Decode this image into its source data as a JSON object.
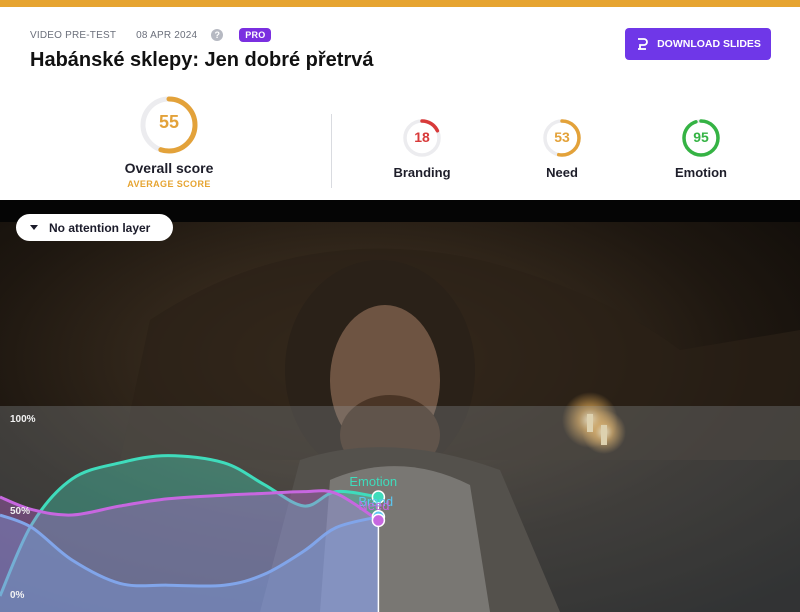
{
  "header": {
    "type": "VIDEO PRE-TEST",
    "date": "08 APR 2024",
    "help": "?",
    "badge": "PRO",
    "title": "Habánské sklepy: Jen dobré přetrvá",
    "download_label": "DOWNLOAD SLIDES"
  },
  "scores": {
    "overall": {
      "value": "55",
      "fraction": 0.55,
      "label": "Overall score",
      "sub": "AVERAGE SCORE",
      "color": "#e3a23a"
    },
    "branding": {
      "value": "18",
      "fraction": 0.18,
      "label": "Branding",
      "color": "#d83a3a"
    },
    "need": {
      "value": "53",
      "fraction": 0.53,
      "label": "Need",
      "color": "#e3a23a"
    },
    "emotion": {
      "value": "95",
      "fraction": 0.95,
      "label": "Emotion",
      "color": "#35b344"
    }
  },
  "video": {
    "attention_label": "No attention layer"
  },
  "chart_data": {
    "type": "area",
    "y_tick_labels": [
      "100%",
      "50%",
      "0%"
    ],
    "ylim": [
      0,
      100
    ],
    "x_range": [
      0,
      1
    ],
    "playhead": 0.473,
    "series": [
      {
        "name": "Emotion",
        "color": "#3fdcbc",
        "x": [
          0,
          0.04,
          0.09,
          0.15,
          0.21,
          0.28,
          0.33,
          0.38,
          0.42,
          0.473
        ],
        "y": [
          0,
          40,
          65,
          74,
          78,
          74,
          62,
          50,
          58,
          55
        ]
      },
      {
        "name": "Brand",
        "color": "#5cc7f0",
        "x": [
          0,
          0.04,
          0.09,
          0.15,
          0.21,
          0.28,
          0.33,
          0.38,
          0.42,
          0.473
        ],
        "y": [
          45,
          38,
          20,
          7,
          6,
          6,
          12,
          25,
          38,
          44
        ]
      },
      {
        "name": "Need",
        "color": "#c767e0",
        "x": [
          0,
          0.04,
          0.09,
          0.15,
          0.21,
          0.28,
          0.33,
          0.38,
          0.42,
          0.473
        ],
        "y": [
          55,
          48,
          45,
          50,
          54,
          56,
          57,
          58,
          57,
          42
        ]
      }
    ]
  }
}
